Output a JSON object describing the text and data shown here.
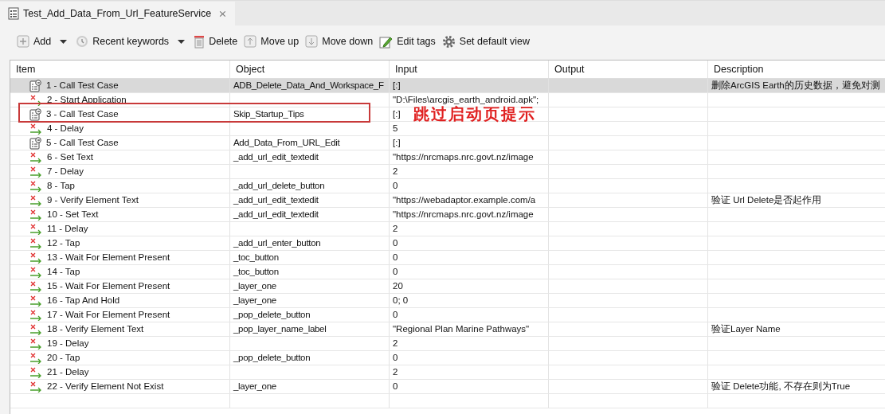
{
  "tab": {
    "title": "Test_Add_Data_From_Url_FeatureService",
    "close": "⨯"
  },
  "toolbar": [
    {
      "kind": "add",
      "label": "Add",
      "dropdown": true
    },
    {
      "kind": "recent",
      "label": "Recent keywords",
      "dropdown": true
    },
    {
      "kind": "delete",
      "label": "Delete",
      "dropdown": false
    },
    {
      "kind": "up",
      "label": "Move up",
      "dropdown": false
    },
    {
      "kind": "down",
      "label": "Move down",
      "dropdown": false
    },
    {
      "kind": "tags",
      "label": "Edit tags",
      "dropdown": false
    },
    {
      "kind": "gear",
      "label": "Set default view",
      "dropdown": false
    }
  ],
  "table": {
    "columns": [
      "Item",
      "Object",
      "Input",
      "Output",
      "Description"
    ],
    "rows": [
      {
        "kind": "call",
        "item": "1 - Call Test Case",
        "object": "ADB_Delete_Data_And_Workspace_F",
        "input": "[:]",
        "description": "删除ArcGIS Earth的历史数据，避免对测",
        "selected": true
      },
      {
        "kind": "step",
        "item": "2 - Start Application",
        "object": "",
        "input": "\"D:\\Files\\arcgis_earth_android.apk\";",
        "description": "",
        "selected": false
      },
      {
        "kind": "call",
        "item": "3 - Call Test Case",
        "object": "Skip_Startup_Tips",
        "input": "[:]",
        "description": "",
        "selected": false,
        "annotation": "跳过启动页提示"
      },
      {
        "kind": "step",
        "item": "4 - Delay",
        "object": "",
        "input": "5",
        "description": "",
        "selected": false
      },
      {
        "kind": "call",
        "item": "5 - Call Test Case",
        "object": "Add_Data_From_URL_Edit",
        "input": "[:]",
        "description": "",
        "selected": false
      },
      {
        "kind": "step",
        "item": "6 - Set Text",
        "object": "_add_url_edit_textedit",
        "input": "\"https://nrcmaps.nrc.govt.nz/image",
        "description": "",
        "selected": false
      },
      {
        "kind": "step",
        "item": "7 - Delay",
        "object": "",
        "input": "2",
        "description": "",
        "selected": false
      },
      {
        "kind": "step",
        "item": "8 - Tap",
        "object": "_add_url_delete_button",
        "input": "0",
        "description": "",
        "selected": false
      },
      {
        "kind": "step",
        "item": "9 - Verify Element Text",
        "object": "_add_url_edit_textedit",
        "input": "\"https://webadaptor.example.com/a",
        "description": "验证 Url Delete是否起作用",
        "selected": false
      },
      {
        "kind": "step",
        "item": "10 - Set Text",
        "object": "_add_url_edit_textedit",
        "input": "\"https://nrcmaps.nrc.govt.nz/image",
        "description": "",
        "selected": false
      },
      {
        "kind": "step",
        "item": "11 - Delay",
        "object": "",
        "input": "2",
        "description": "",
        "selected": false
      },
      {
        "kind": "step",
        "item": "12 - Tap",
        "object": "_add_url_enter_button",
        "input": "0",
        "description": "",
        "selected": false
      },
      {
        "kind": "step",
        "item": "13 - Wait For Element Present",
        "object": "_toc_button",
        "input": "0",
        "description": "",
        "selected": false
      },
      {
        "kind": "step",
        "item": "14 - Tap",
        "object": "_toc_button",
        "input": "0",
        "description": "",
        "selected": false
      },
      {
        "kind": "step",
        "item": "15 - Wait For Element Present",
        "object": "_layer_one",
        "input": "20",
        "description": "",
        "selected": false
      },
      {
        "kind": "step",
        "item": "16 - Tap And Hold",
        "object": "_layer_one",
        "input": "0; 0",
        "description": "",
        "selected": false
      },
      {
        "kind": "step",
        "item": "17 - Wait For Element Present",
        "object": "_pop_delete_button",
        "input": "0",
        "description": "",
        "selected": false
      },
      {
        "kind": "step",
        "item": "18 - Verify Element Text",
        "object": "_pop_layer_name_label",
        "input": "\"Regional Plan Marine Pathways\"",
        "description": "验证Layer Name",
        "selected": false
      },
      {
        "kind": "step",
        "item": "19 - Delay",
        "object": "",
        "input": "2",
        "description": "",
        "selected": false
      },
      {
        "kind": "step",
        "item": "20 - Tap",
        "object": "_pop_delete_button",
        "input": "0",
        "description": "",
        "selected": false
      },
      {
        "kind": "step",
        "item": "21 - Delay",
        "object": "",
        "input": "2",
        "description": "",
        "selected": false
      },
      {
        "kind": "step",
        "item": "22 - Verify Element Not Exist",
        "object": "_layer_one",
        "input": "0",
        "description": "验证 Delete功能, 不存在则为True",
        "selected": false
      }
    ]
  }
}
